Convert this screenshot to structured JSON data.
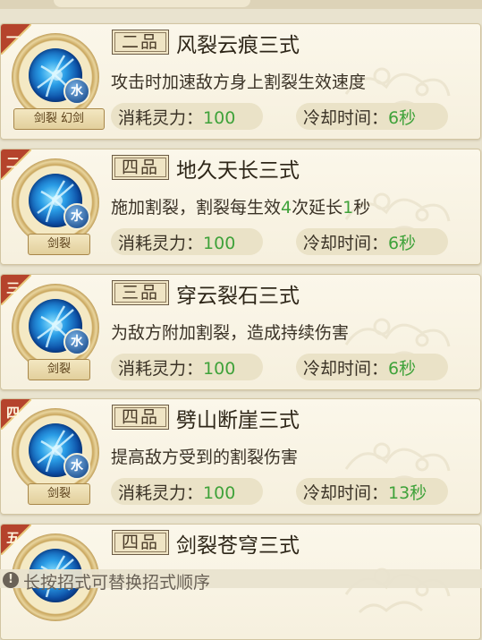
{
  "skills": [
    {
      "order": "一",
      "corner_color": "#b5432c",
      "grade": "二品",
      "name": "风裂云痕三式",
      "desc": [
        {
          "t": "攻击时加速敌方身上割裂生效速度"
        }
      ],
      "tags": "剑裂 幻剑",
      "element": "水",
      "cost_label": "消耗灵力：",
      "cost": "100",
      "cd_label": "冷却时间：",
      "cd": "6秒"
    },
    {
      "order": "二",
      "corner_color": "#b5432c",
      "grade": "四品",
      "name": "地久天长三式",
      "desc": [
        {
          "t": "施加割裂，割裂每生效"
        },
        {
          "t": "4",
          "hl": true
        },
        {
          "t": "次延长"
        },
        {
          "t": "1",
          "hl": true
        },
        {
          "t": "秒"
        }
      ],
      "tags": "剑裂",
      "element": "水",
      "cost_label": "消耗灵力：",
      "cost": "100",
      "cd_label": "冷却时间：",
      "cd": "6秒"
    },
    {
      "order": "三",
      "corner_color": "#b5432c",
      "grade": "三品",
      "name": "穿云裂石三式",
      "desc": [
        {
          "t": "为敌方附加割裂，造成持续伤害"
        }
      ],
      "tags": "剑裂",
      "element": "水",
      "cost_label": "消耗灵力：",
      "cost": "100",
      "cd_label": "冷却时间：",
      "cd": "6秒"
    },
    {
      "order": "四",
      "corner_color": "#b5432c",
      "grade": "四品",
      "name": "劈山断崖三式",
      "desc": [
        {
          "t": "提高敌方受到的割裂伤害"
        }
      ],
      "tags": "剑裂",
      "element": "水",
      "cost_label": "消耗灵力：",
      "cost": "100",
      "cd_label": "冷却时间：",
      "cd": "13秒"
    },
    {
      "order": "五",
      "corner_color": "#b5432c",
      "grade": "四品",
      "name": "剑裂苍穹三式",
      "desc": [],
      "tags": "",
      "element": "",
      "cost_label": "",
      "cost": "",
      "cd_label": "",
      "cd": ""
    }
  ],
  "hint": {
    "icon": "info-icon",
    "text": "长按招式可替换招式顺序"
  },
  "colors": {
    "accent_green": "#3fa23a",
    "water_orb": "#2a9de6"
  }
}
